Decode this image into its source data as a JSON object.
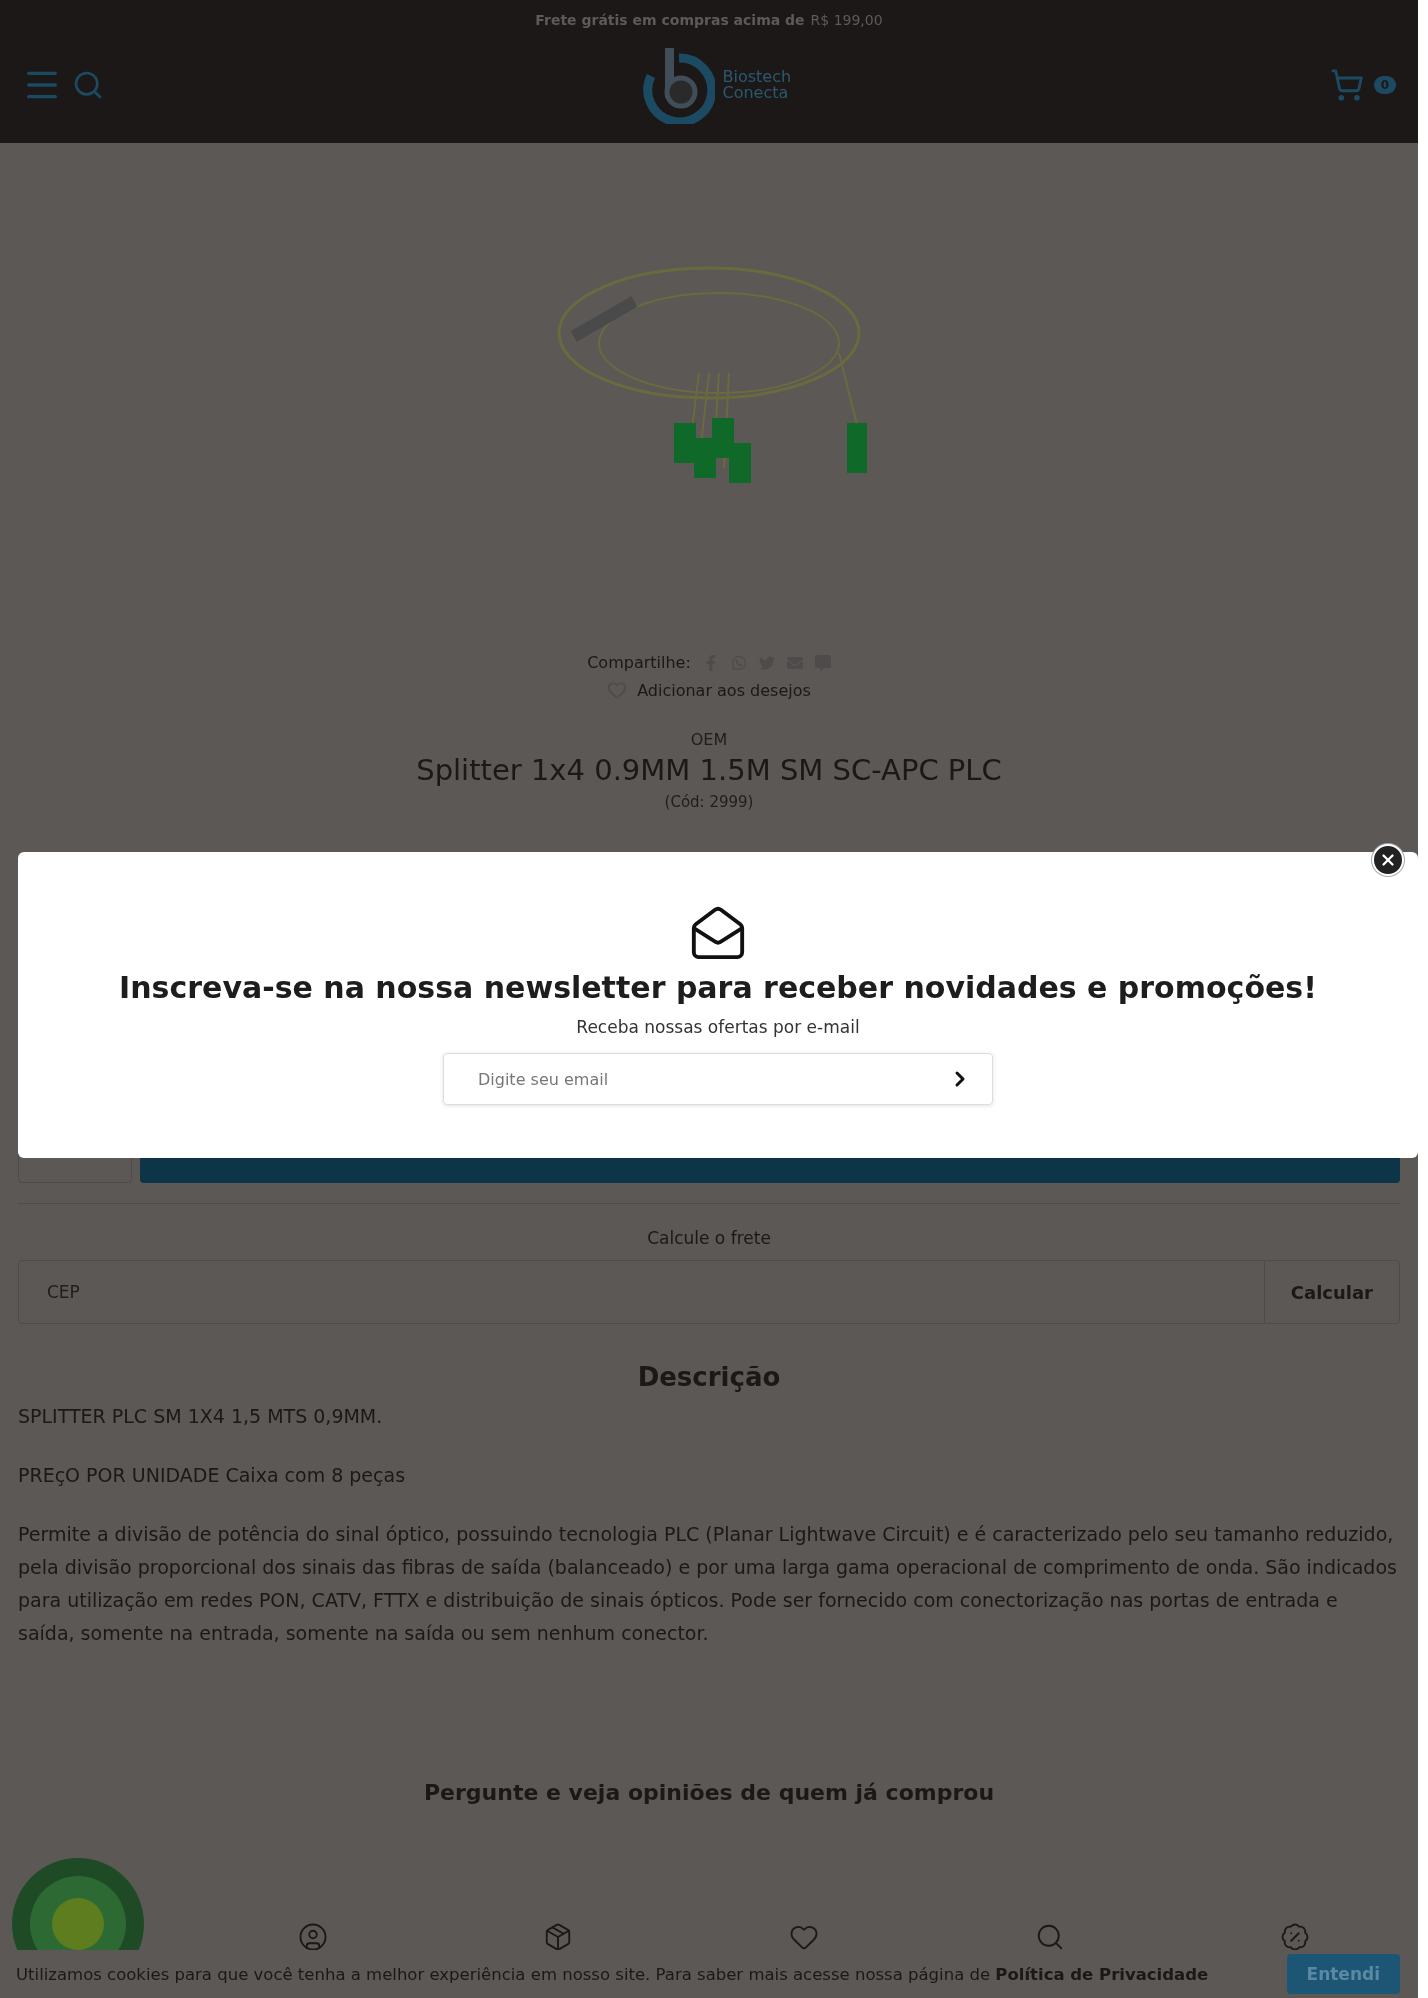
{
  "topbar": {
    "text": "Frete grátis em compras acima de",
    "amount": "R$ 199,00"
  },
  "header": {
    "logo_line1": "Biostech",
    "logo_line2": "Conecta",
    "cart_count": "0"
  },
  "share": {
    "label": "Compartilhe:"
  },
  "wishlist": {
    "label": "Adicionar aos desejos"
  },
  "product": {
    "brand": "OEM",
    "title": "Splitter 1x4 0.9MM 1.5M SM SC-APC PLC",
    "code": "(Cód: 2999)"
  },
  "newsletter": {
    "title": "Inscreva-se na nossa newsletter para receber novidades e promoções!",
    "subtitle": "Receba nossas ofertas por e-mail",
    "placeholder": "Digite seu email"
  },
  "shipping": {
    "title": "Calcule o frete",
    "placeholder": "CEP",
    "button": "Calcular"
  },
  "description": {
    "heading": "Descrição",
    "paragraphs": [
      "SPLITTER PLC SM 1X4 1,5 MTS 0,9MM.",
      "PREçO POR UNIDADE Caixa com 8 peças",
      "Permite a divisão de potência do sinal óptico, possuindo tecnologia PLC (Planar Lightwave Circuit) e é caracterizado pelo seu tamanho reduzido, pela divisão proporcional dos sinais das fibras de saída (balanceado) e por uma larga gama operacional de comprimento de onda. São indicados para utilização em redes PON, CATV, FTTX e distribuição de sinais ópticos. Pode ser fornecido com conectorização nas portas de entrada e saída, somente na entrada, somente na saída ou sem nenhum conector."
    ]
  },
  "reviews": {
    "heading": "Pergunte e veja opiniões de quem já comprou"
  },
  "cookie": {
    "text": "Utilizamos cookies para que você tenha a melhor experiência em nosso site. Para saber mais acesse nossa página de **Política de Privacidade**",
    "button": "Entendi"
  }
}
